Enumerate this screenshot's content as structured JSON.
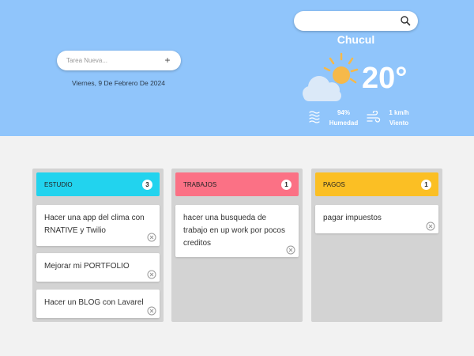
{
  "task_input": {
    "placeholder": "Tarea Nueva...",
    "add_label": "+"
  },
  "date": "Viernes, 9 De Febrero De 2024",
  "weather": {
    "city": "Chucul",
    "temperature": "20°",
    "humidity_value": "94%",
    "humidity_label": "Humedad",
    "wind_value": "1 km/h",
    "wind_label": "Viento",
    "condition_icon": "partly-cloudy-icon"
  },
  "colors": {
    "header_bg": "#90c5fb",
    "estudio": "#22d3ee",
    "trabajos": "#fb7185",
    "pagos": "#fbbf24"
  },
  "columns": [
    {
      "title": "ESTUDIO",
      "count": "3",
      "cards": [
        "Hacer una app del clima con RNATIVE y Twilio",
        "Mejorar mi PORTFOLIO",
        "Hacer un BLOG con Lavarel"
      ]
    },
    {
      "title": "TRABAJOS",
      "count": "1",
      "cards": [
        "hacer una busqueda de trabajo en up work por pocos creditos"
      ]
    },
    {
      "title": "PAGOS",
      "count": "1",
      "cards": [
        "pagar impuestos"
      ]
    }
  ]
}
